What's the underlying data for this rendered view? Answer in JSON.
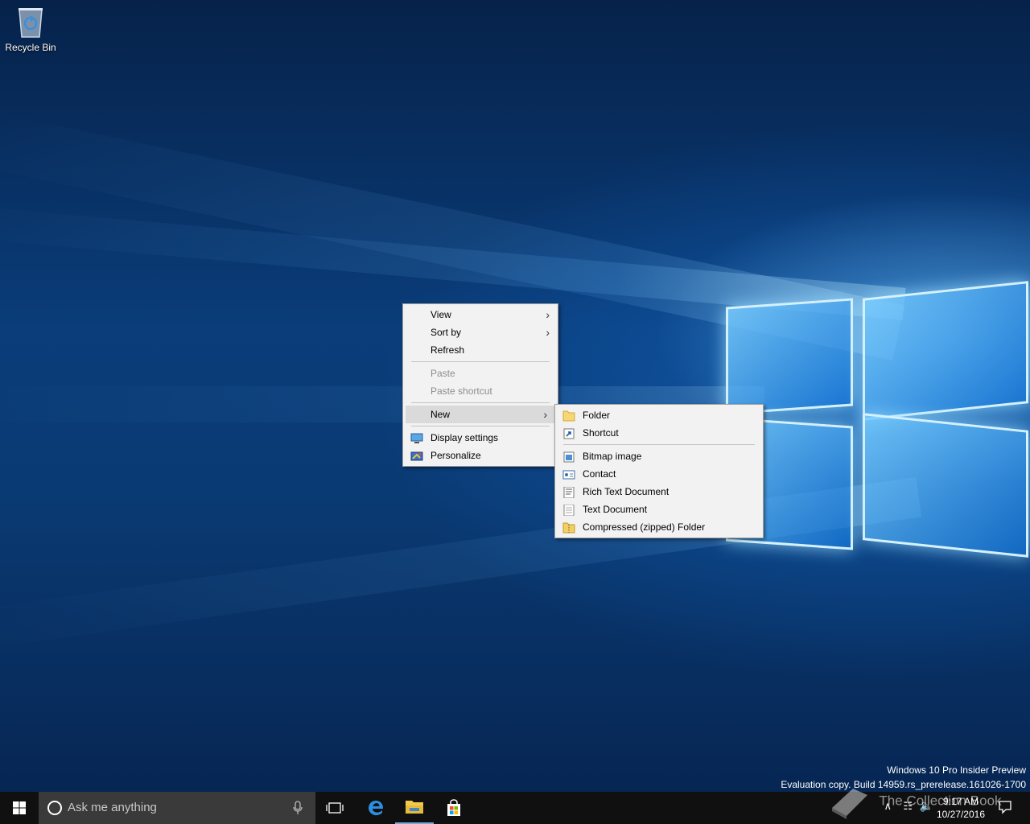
{
  "desktop": {
    "icons": [
      {
        "label": "Recycle Bin",
        "icon": "recycle-bin-icon"
      }
    ]
  },
  "context_menu": {
    "items": [
      {
        "label": "View",
        "submenu": true,
        "enabled": true
      },
      {
        "label": "Sort by",
        "submenu": true,
        "enabled": true
      },
      {
        "label": "Refresh",
        "enabled": true
      },
      {
        "label": "Paste",
        "enabled": false
      },
      {
        "label": "Paste shortcut",
        "enabled": false
      },
      {
        "label": "New",
        "submenu": true,
        "enabled": true,
        "highlighted": true
      },
      {
        "label": "Display settings",
        "icon": "display-icon",
        "enabled": true
      },
      {
        "label": "Personalize",
        "icon": "personalize-icon",
        "enabled": true
      }
    ]
  },
  "new_submenu": {
    "items": [
      {
        "label": "Folder",
        "icon": "folder-icon"
      },
      {
        "label": "Shortcut",
        "icon": "shortcut-icon"
      },
      {
        "label": "Bitmap image",
        "icon": "bitmap-icon"
      },
      {
        "label": "Contact",
        "icon": "contact-icon"
      },
      {
        "label": "Rich Text Document",
        "icon": "rich-text-icon"
      },
      {
        "label": "Text Document",
        "icon": "text-document-icon"
      },
      {
        "label": "Compressed (zipped) Folder",
        "icon": "zip-folder-icon"
      }
    ]
  },
  "watermark": {
    "line1": "Windows 10 Pro Insider Preview",
    "line2": "Evaluation copy. Build 14959.rs_prerelease.161026-1700"
  },
  "taskbar": {
    "search_placeholder": "Ask me anything",
    "clock_time": "9:17 AM",
    "clock_date": "10/27/2016",
    "pinned": [
      "task-view-icon",
      "edge-icon",
      "file-explorer-icon",
      "store-icon"
    ]
  },
  "overlay": {
    "text": "The Collection Book"
  },
  "colors": {
    "menu_bg": "#f2f2f2",
    "menu_highlight": "#dadada",
    "taskbar_bg": "#101010",
    "search_bg": "#3a3a3a",
    "accent": "#0078d7"
  }
}
